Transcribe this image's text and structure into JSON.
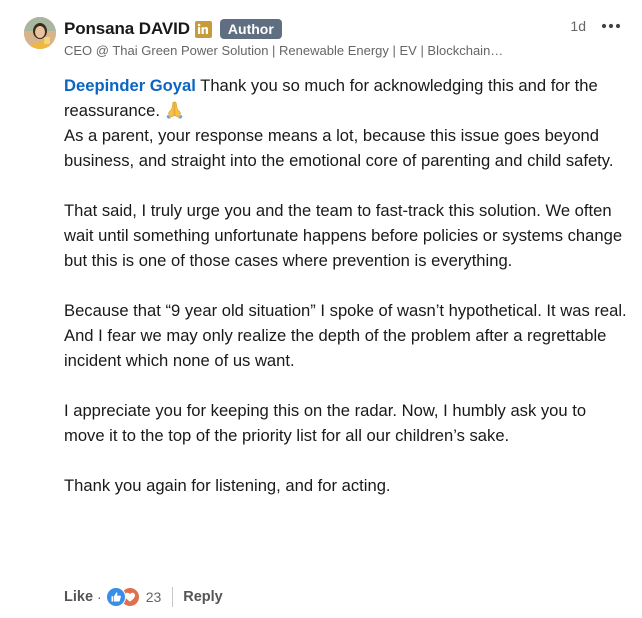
{
  "author": {
    "name": "Ponsana DAVID",
    "badge": "Author",
    "headline": "CEO @ Thai Green Power Solution | Renewable Energy | EV | Blockchain…",
    "time": "1d"
  },
  "icons": {
    "avatar": "avatar-photo",
    "linkedin": "linkedin-icon",
    "more": "more-icon",
    "pray": "folded-hands-emoji",
    "like_reaction": "like-reaction-icon",
    "love_reaction": "love-reaction-icon"
  },
  "colors": {
    "mention": "#0a66c2",
    "badge_bg": "#5f6e80",
    "linkedin_icon": "#c79a3b",
    "like_reaction": "#378fe9",
    "love_reaction": "#df704d"
  },
  "comment": {
    "mention": "Deepinder Goyal",
    "line1_rest": " Thank you so much for acknowledging this and for the reassurance. ",
    "line1_tail": "As a parent, your response means a lot, because this issue goes beyond business, and straight into the emotional core of parenting and child safety.",
    "para2": "That said, I truly urge you and the team to fast-track this solution. We often wait until something unfortunate happens before policies or systems change but this is one of those cases where prevention is everything.",
    "para3a": "Because that “9 year old situation” I spoke of wasn’t hypothetical. It was real.",
    "para3b": "And I fear we may only realize the depth of the problem after a regrettable incident which none of us want.",
    "para4": "I appreciate you for keeping this on the radar. Now, I humbly ask you to move it to the top of the priority list for all our children’s sake.",
    "para5": "Thank you again for listening, and for acting."
  },
  "footer": {
    "like_label": "Like",
    "separator": "·",
    "reaction_count": "23",
    "reply_label": "Reply"
  }
}
